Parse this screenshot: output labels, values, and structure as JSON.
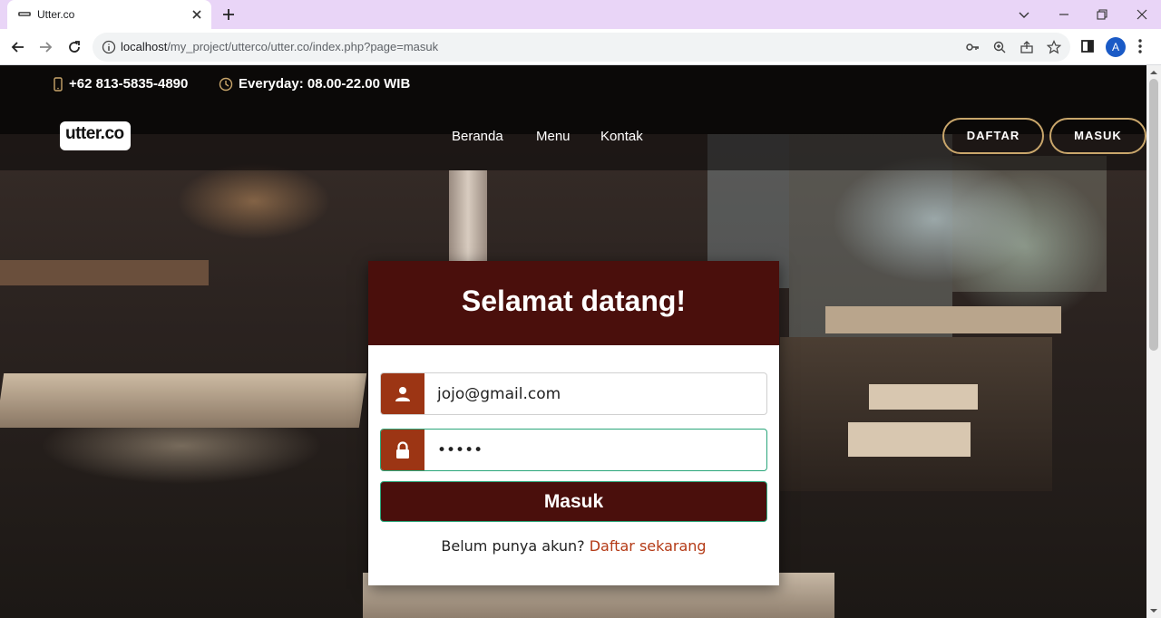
{
  "browser": {
    "tab_title": "Utter.co",
    "url_host": "localhost",
    "url_path": "/my_project/utterco/utter.co/index.php?page=masuk",
    "profile_initial": "A"
  },
  "topbar": {
    "phone": "+62 813-5835-4890",
    "hours": "Everyday: 08.00-22.00 WIB"
  },
  "brand": {
    "logo_text": "utter.co"
  },
  "nav": {
    "links": [
      "Beranda",
      "Menu",
      "Kontak"
    ],
    "register_label": "DAFTAR",
    "login_label": "MASUK"
  },
  "login": {
    "title": "Selamat datang!",
    "email_value": "jojo@gmail.com",
    "password_value": "•••••",
    "submit_label": "Masuk",
    "signup_prompt": "Belum punya akun?",
    "signup_link": "Daftar sekarang"
  },
  "colors": {
    "accent": "#4a0f0c",
    "icon_bg": "#9c3514",
    "link": "#b43a16",
    "button_border": "#c9a66b",
    "tabbar": "#e9d5f7"
  }
}
